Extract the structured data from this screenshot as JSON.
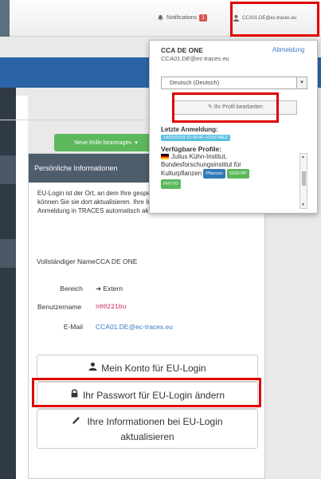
{
  "topbar": {
    "notifications_label": "Notifications",
    "notifications_count": "1",
    "user_email": "CCA01.DE@ec-traces.eu"
  },
  "toolbar": {
    "request_role_label": "Neue Rolle beantragen"
  },
  "panel": {
    "title": "Persönliche Informationen",
    "intro": "EU-Login ist der Ort, an dem Ihre gespeichert werden. Wenn die I falsch sind, können Sie sie dort aktualisieren. Ihre Informationen werden bei der nächsten Anmeldung in TRACES automatisch aktualisiert.",
    "fields": {
      "full_name_label": "Vollständiger Name",
      "full_name_value": "CCA DE ONE",
      "area_label": "Bereich",
      "area_value": "Extern",
      "username_label": "Benutzername",
      "username_value": "n00221bu",
      "email_label": "E-Mail",
      "email_value": "CCA01.DE@ec-traces.eu"
    },
    "buttons": {
      "account": "Mein Konto für EU-Login",
      "password": "Ihr Passwort für EU-Login ändern",
      "update_line1": "Ihre Informationen bei EU-Login",
      "update_line2": "aktualisieren"
    }
  },
  "dropdown": {
    "name": "CCA DE ONE",
    "email": "CCA01.DE@ec-traces.eu",
    "logout": "Abmeldung",
    "language_selected": "Deutsch (Deutsch)",
    "edit_profile": "Ihr Profil bearbeiten",
    "last_login_label": "Letzte Anmeldung:",
    "last_login_value": "14/03/2019 10:40:40 +0100 MEZ",
    "profiles_label": "Verfügbare Profile:",
    "institute_line1": "Julius Kühn-Institut,",
    "institute_line2": "Bundesforschungsinstitut für",
    "institute_line3": "Kulturpflanzen",
    "tags": [
      "Pflanzen",
      "GGD-PP",
      "PHYTO"
    ]
  },
  "colors": {
    "highlight": "#e00000",
    "accent_blue": "#2b64a6",
    "green": "#5cb85c",
    "panel_header": "#4e5d6c"
  }
}
